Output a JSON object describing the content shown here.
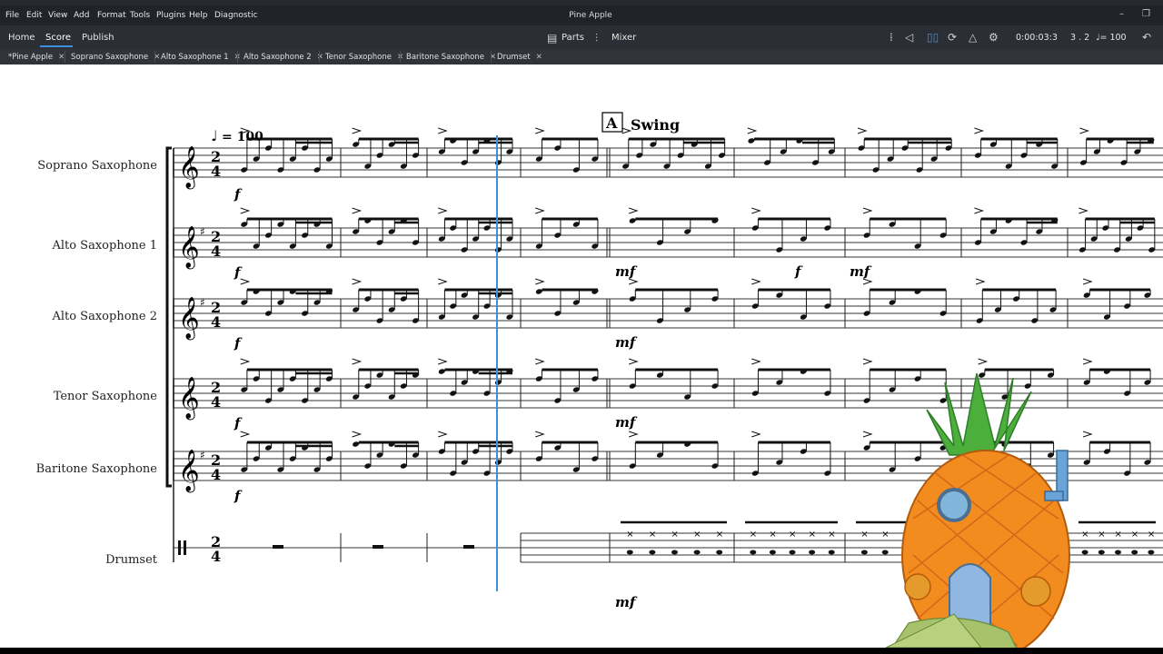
{
  "menubar": {
    "items": [
      "File",
      "Edit",
      "View",
      "Add",
      "Format",
      "Tools",
      "Plugins",
      "Help",
      "Diagnostic"
    ],
    "title": "Pine Apple",
    "window_controls": [
      "–",
      "❐"
    ]
  },
  "toolbar": {
    "tabs": [
      "Home",
      "Score",
      "Publish"
    ],
    "active_tab": "Score",
    "parts_label": "Parts",
    "mixer_label": "Mixer",
    "time": "0:00:03:3",
    "position": "3 . 2",
    "tempo": "♩= 100",
    "icons": [
      "grip-icon",
      "rewind-icon",
      "play-icon",
      "loop-icon",
      "metronome-icon",
      "settings-icon",
      "undo-icon"
    ]
  },
  "score_tabs": [
    "*Pine Apple",
    "Soprano Saxophone",
    "Alto Saxophone 1",
    "Alto Saxophone 2",
    "Tenor Saxophone",
    "Baritone Saxophone",
    "Drumset"
  ],
  "score": {
    "tempo_marking": "= 100",
    "rehearsal_mark": "A",
    "section_text": "Swing",
    "time_signature": [
      "2",
      "4"
    ],
    "instruments": [
      "Soprano Saxophone",
      "Alto Saxophone 1",
      "Alto Saxophone 2",
      "Tenor Saxophone",
      "Baritone Saxophone",
      "Drumset"
    ],
    "dynamics": [
      "f",
      "f",
      "f",
      "f",
      "f",
      "mf",
      "mf",
      "mf",
      "mf",
      "f",
      "mf"
    ],
    "playhead_color": "#3a8ee6",
    "accent_color": "#3b8fe0"
  }
}
